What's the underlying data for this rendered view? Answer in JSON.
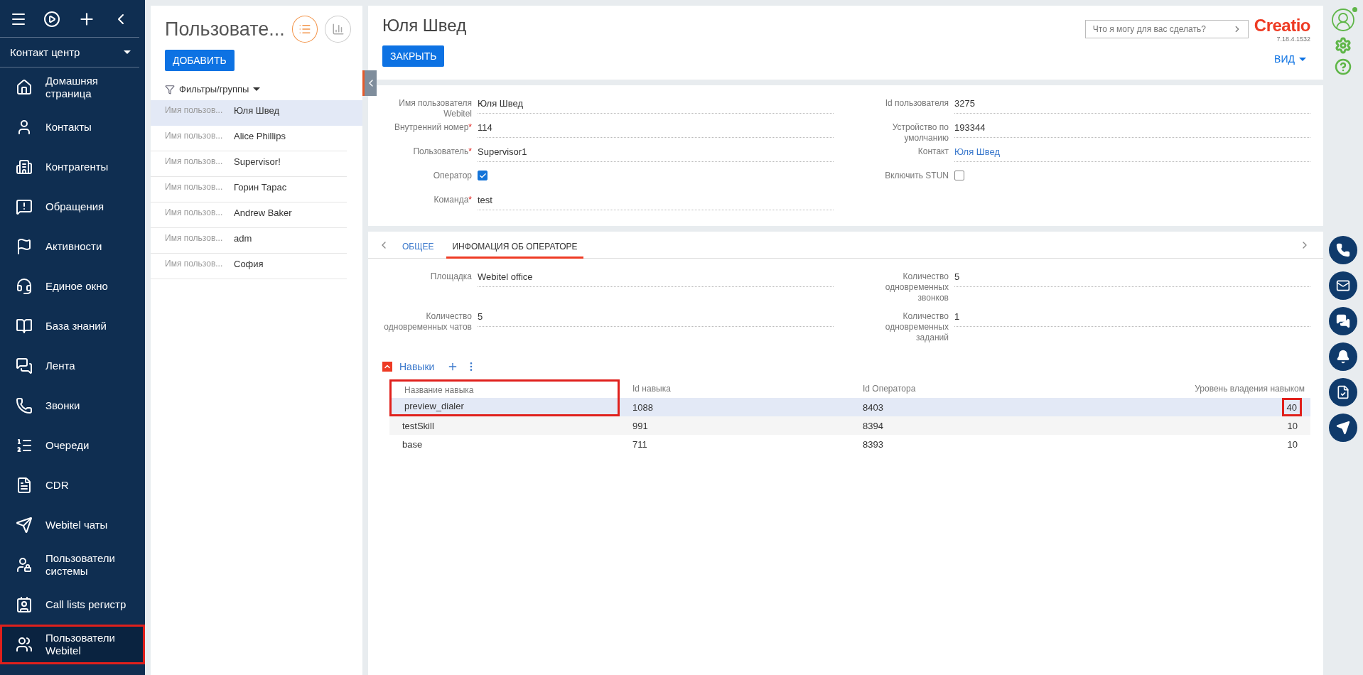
{
  "sidebar": {
    "section": "Контакт центр",
    "items": [
      {
        "label": "Домашняя страница",
        "selected": false,
        "highlighted": false
      },
      {
        "label": "Контакты",
        "selected": false,
        "highlighted": false
      },
      {
        "label": "Контрагенты",
        "selected": false,
        "highlighted": false
      },
      {
        "label": "Обращения",
        "selected": false,
        "highlighted": false
      },
      {
        "label": "Активности",
        "selected": false,
        "highlighted": false
      },
      {
        "label": "Единое окно",
        "selected": false,
        "highlighted": false
      },
      {
        "label": "База знаний",
        "selected": false,
        "highlighted": false
      },
      {
        "label": "Лента",
        "selected": false,
        "highlighted": false
      },
      {
        "label": "Звонки",
        "selected": false,
        "highlighted": false
      },
      {
        "label": "Очереди",
        "selected": false,
        "highlighted": false
      },
      {
        "label": "CDR",
        "selected": false,
        "highlighted": false
      },
      {
        "label": "Webitel чаты",
        "selected": false,
        "highlighted": false
      },
      {
        "label": "Пользователи системы",
        "selected": false,
        "highlighted": false
      },
      {
        "label": "Call lists регистр",
        "selected": false,
        "highlighted": false
      },
      {
        "label": "Пользователи Webitel",
        "selected": true,
        "highlighted": true
      }
    ]
  },
  "list": {
    "title": "Пользовате...",
    "add_button": "ДОБАВИТЬ",
    "filters": "Фильтры/группы",
    "view_list_selected": true,
    "rows": [
      {
        "caption": "Имя пользов...",
        "value": "Юля Швед",
        "selected": true
      },
      {
        "caption": "Имя пользов...",
        "value": "Alice Phillips",
        "selected": false
      },
      {
        "caption": "Имя пользов...",
        "value": "Supervisor!",
        "selected": false
      },
      {
        "caption": "Имя пользов...",
        "value": "Горин Тарас",
        "selected": false
      },
      {
        "caption": "Имя пользов...",
        "value": "Andrew Baker",
        "selected": false
      },
      {
        "caption": "Имя пользов...",
        "value": "adm",
        "selected": false
      },
      {
        "caption": "Имя пользов...",
        "value": "София",
        "selected": false
      }
    ]
  },
  "header": {
    "title": "Юля Швед",
    "close_button": "ЗАКРЫТЬ",
    "search_placeholder": "Что я могу для вас сделать?",
    "logo": "Creatio",
    "version": "7.18.4.1532",
    "view_button": "ВИД"
  },
  "details": {
    "left": [
      {
        "kind": "text",
        "label": "Имя пользователя Webitel",
        "value": "Юля Швед"
      },
      {
        "kind": "text",
        "label": "Внутренний номер",
        "required_mark": "*",
        "value": "114"
      },
      {
        "kind": "text",
        "label": "Пользователь",
        "required_mark": "*",
        "value": "Supervisor1"
      },
      {
        "kind": "checkbox",
        "label": "Оператор",
        "checked": true
      },
      {
        "kind": "text",
        "label": "Команда",
        "required_mark": "*",
        "value": "test"
      }
    ],
    "right": [
      {
        "kind": "text",
        "label": "Id пользователя",
        "value": "3275"
      },
      {
        "kind": "text",
        "label": "Устройство по умолчанию",
        "value": "193344"
      },
      {
        "kind": "link",
        "label": "Контакт",
        "value": "Юля Швед"
      },
      {
        "kind": "checkbox",
        "label": "Включить STUN",
        "checked": false
      }
    ]
  },
  "tabs": [
    {
      "label": "ОБЩЕЕ",
      "selected": false
    },
    {
      "label": "ИНФОМАЦИЯ ОБ ОПЕРАТОРЕ",
      "selected": true
    }
  ],
  "operator_info": {
    "left": [
      {
        "label": "Площадка",
        "value": "Webitel office"
      },
      {
        "label": "Количество одновременных чатов",
        "value": "5"
      }
    ],
    "right": [
      {
        "label": "Количество одновременных звонков",
        "value": "5"
      },
      {
        "label": "Количество одновременных заданий",
        "value": "1"
      }
    ]
  },
  "skills": {
    "title": "Навыки",
    "expanded": true,
    "columns": [
      {
        "label": "Название навыка",
        "highlighted": true
      },
      {
        "label": "Id навыка",
        "highlighted": false
      },
      {
        "label": "Id Оператора",
        "highlighted": false
      },
      {
        "label": "Уровень владения навыком",
        "highlighted": false
      }
    ],
    "rows": [
      {
        "cells": [
          {
            "text": "preview_dialer",
            "highlighted": true
          },
          {
            "text": "1088",
            "highlighted": false
          },
          {
            "text": "8403",
            "highlighted": false
          },
          {
            "text": "40",
            "highlighted": true
          }
        ],
        "selected": true
      },
      {
        "cells": [
          {
            "text": "testSkill",
            "highlighted": false
          },
          {
            "text": "991",
            "highlighted": false
          },
          {
            "text": "8394",
            "highlighted": false
          },
          {
            "text": "10",
            "highlighted": false
          }
        ],
        "selected": false
      },
      {
        "cells": [
          {
            "text": "base",
            "highlighted": false
          },
          {
            "text": "711",
            "highlighted": false
          },
          {
            "text": "8393",
            "highlighted": false
          },
          {
            "text": "10",
            "highlighted": false
          }
        ],
        "selected": false
      }
    ]
  }
}
